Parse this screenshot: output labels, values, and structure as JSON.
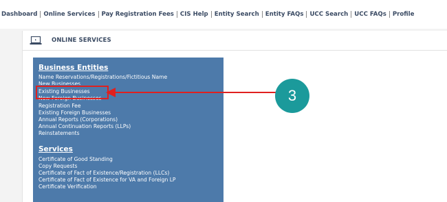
{
  "nav": {
    "items": [
      "Dashboard",
      "Online Services",
      "Pay Registration Fees",
      "CIS Help",
      "Entity Search",
      "Entity FAQs",
      "UCC Search",
      "UCC FAQs",
      "Profile"
    ]
  },
  "panel": {
    "icon": "laptop-icon",
    "title": "ONLINE SERVICES"
  },
  "business_entities": {
    "heading": "Business Entities",
    "links": [
      "Name Reservations/Registrations/Fictitious Name",
      "New Businesses",
      "Existing Businesses",
      "New Foreign Businesses",
      "Registration Fee",
      "Existing Foreign Businesses",
      "Annual Reports (Corporations)",
      "Annual Continuation Reports (LLPs)",
      "Reinstatements"
    ]
  },
  "services": {
    "heading": "Services",
    "links": [
      "Certificate of Good Standing",
      "Copy Requests",
      "Certificate of Fact of Existence/Registration (LLCs)",
      "Certificate of Fact of Existence for VA and Foreign LP",
      "Certificate Verification"
    ]
  },
  "annotation": {
    "step": "3",
    "highlight_color": "#e0201e",
    "circle_color": "#1b9a9b"
  },
  "colors": {
    "box_bg": "#4d7aaa",
    "nav_text": "#3a4a63"
  }
}
